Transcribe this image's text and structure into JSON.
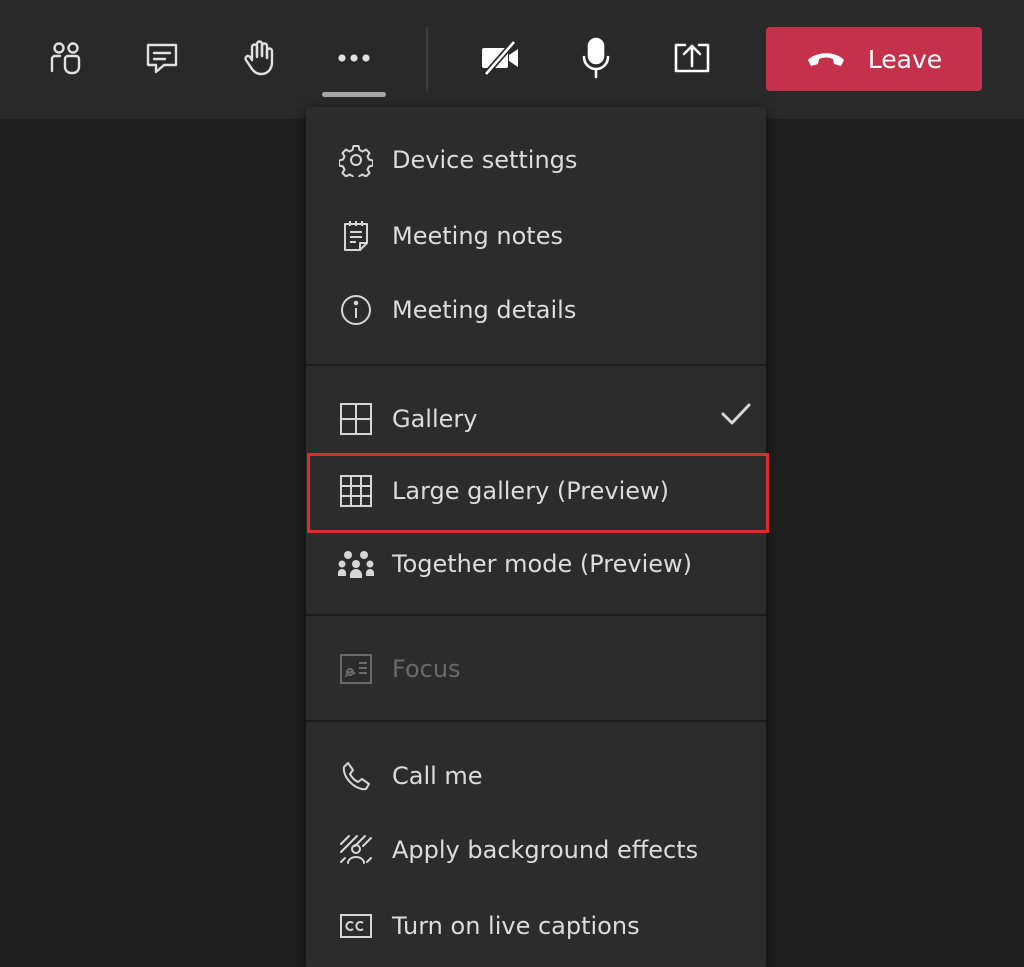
{
  "toolbar": {
    "buttons": [
      {
        "name": "people",
        "icon": "people-icon"
      },
      {
        "name": "chat",
        "icon": "chat-icon"
      },
      {
        "name": "raise-hand",
        "icon": "raise-hand-icon"
      },
      {
        "name": "more-actions",
        "icon": "more-icon"
      },
      {
        "name": "camera-off",
        "icon": "camera-off-icon"
      },
      {
        "name": "microphone",
        "icon": "microphone-icon"
      },
      {
        "name": "share",
        "icon": "share-icon"
      }
    ],
    "leave": {
      "label": "Leave",
      "icon": "hang-up-icon",
      "color": "#c4314b"
    }
  },
  "menu": {
    "groups": [
      {
        "items": [
          {
            "label": "Device settings",
            "icon": "gear-icon"
          },
          {
            "label": "Meeting notes",
            "icon": "notes-icon"
          },
          {
            "label": "Meeting details",
            "icon": "info-icon"
          }
        ]
      },
      {
        "items": [
          {
            "label": "Gallery",
            "icon": "gallery-icon",
            "checked": true
          },
          {
            "label": "Large gallery (Preview)",
            "icon": "large-gallery-icon",
            "highlighted": true
          },
          {
            "label": "Together mode (Preview)",
            "icon": "together-mode-icon"
          }
        ]
      },
      {
        "items": [
          {
            "label": "Focus",
            "icon": "focus-icon",
            "disabled": true
          }
        ]
      },
      {
        "items": [
          {
            "label": "Call me",
            "icon": "phone-icon"
          },
          {
            "label": "Apply background effects",
            "icon": "background-effects-icon"
          },
          {
            "label": "Turn on live captions",
            "icon": "captions-icon"
          }
        ]
      }
    ]
  },
  "colors": {
    "toolbar_bg": "#292929",
    "menu_bg": "#2d2c2c",
    "page_bg": "#1f1f1f",
    "highlight_border": "#e02b2b",
    "text": "#dcdcdc",
    "disabled_text": "#6a6a6a"
  }
}
